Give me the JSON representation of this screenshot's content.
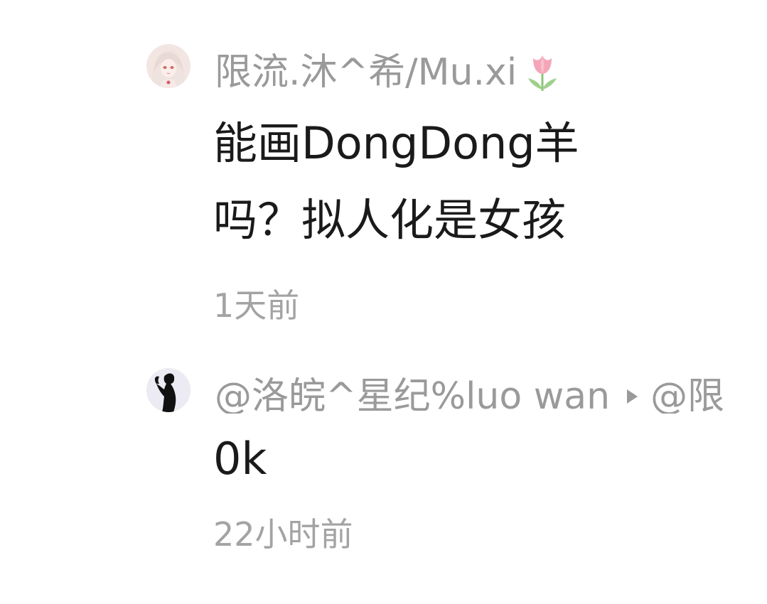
{
  "comments": [
    {
      "username": "限流.沐^希/Mu.xi",
      "username_icon": "tulip-icon",
      "avatar": "anime-girl-avatar",
      "text": "能画DongDong羊吗？拟人化是女孩",
      "time": "1天前"
    },
    {
      "username": "@洛皖^星纪%luo wan",
      "reply_to": "@限",
      "avatar": "silhouette-avatar",
      "text": "0k",
      "time": "22小时前"
    }
  ],
  "colors": {
    "username": "#9a9a9a",
    "text": "#1a1a1a",
    "timestamp": "#a3a3a3",
    "tulip": "#f4a6b8"
  }
}
